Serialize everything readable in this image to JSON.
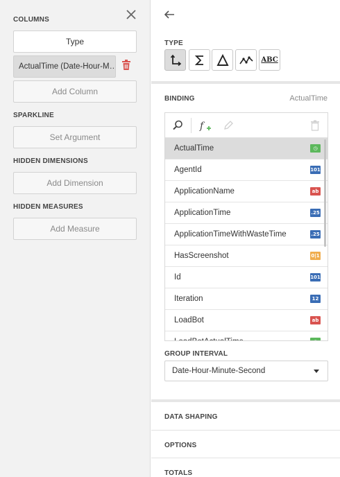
{
  "left": {
    "columns_title": "COLUMNS",
    "type_button": "Type",
    "column_chip": "ActualTime (Date-Hour-M…",
    "add_column": "Add Column",
    "sparkline_title": "SPARKLINE",
    "set_argument": "Set Argument",
    "hidden_dimensions_title": "HIDDEN DIMENSIONS",
    "add_dimension": "Add Dimension",
    "hidden_measures_title": "HIDDEN MEASURES",
    "add_measure": "Add Measure"
  },
  "right": {
    "type_title": "TYPE",
    "type_buttons": [
      {
        "icon": "dimension-axis-icon",
        "active": true
      },
      {
        "icon": "sum-icon",
        "active": false
      },
      {
        "icon": "delta-icon",
        "active": false
      },
      {
        "icon": "sparkline-icon",
        "active": false
      },
      {
        "icon": "abc-icon",
        "text": "ABC",
        "active": false
      }
    ],
    "binding_title": "BINDING",
    "binding_value": "ActualTime",
    "fields": [
      {
        "name": "ActualTime",
        "badge": "◷",
        "color": "#5cb85c",
        "selected": true
      },
      {
        "name": "AgentId",
        "badge": "101",
        "color": "#3a6db5"
      },
      {
        "name": "ApplicationName",
        "badge": "ab",
        "color": "#d9534f"
      },
      {
        "name": "ApplicationTime",
        "badge": ".25",
        "color": "#3a6db5"
      },
      {
        "name": "ApplicationTimeWithWasteTime",
        "badge": ".25",
        "color": "#3a6db5"
      },
      {
        "name": "HasScreenshot",
        "badge": "0|1",
        "color": "#f0ad4e"
      },
      {
        "name": "Id",
        "badge": "101",
        "color": "#3a6db5"
      },
      {
        "name": "Iteration",
        "badge": "12",
        "color": "#3a6db5"
      },
      {
        "name": "LoadBot",
        "badge": "ab",
        "color": "#d9534f"
      },
      {
        "name": "LoadBotActualTime",
        "badge": "◷",
        "color": "#5cb85c"
      }
    ],
    "group_interval_title": "GROUP INTERVAL",
    "group_interval_value": "Date-Hour-Minute-Second",
    "data_shaping": "DATA SHAPING",
    "options": "OPTIONS",
    "totals": "TOTALS"
  }
}
